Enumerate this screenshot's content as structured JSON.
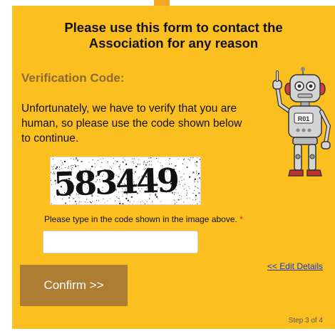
{
  "form": {
    "heading_line1": "Please use this form to contact the",
    "heading_line2": "Association for any reason",
    "section_title": "Verification Code:",
    "intro": "Unfortunately, we have to verify that you are human, so please use the code shown below to continue.",
    "captcha_text": "583449",
    "code_label": "Please type in the code shown in the image above.",
    "required_marker": "*",
    "code_value": "",
    "confirm_label": "Confirm >>",
    "edit_link": "<< Edit Details",
    "step_text": "Step 3 of 4",
    "robot_badge": "R01"
  },
  "colors": {
    "panel": "#fcbf20",
    "button": "#ae7d34",
    "section_title": "#8a6a33",
    "link": "#1a35c8",
    "required": "#d92121"
  },
  "icons": {
    "mascot": "robot-mascot-icon"
  }
}
